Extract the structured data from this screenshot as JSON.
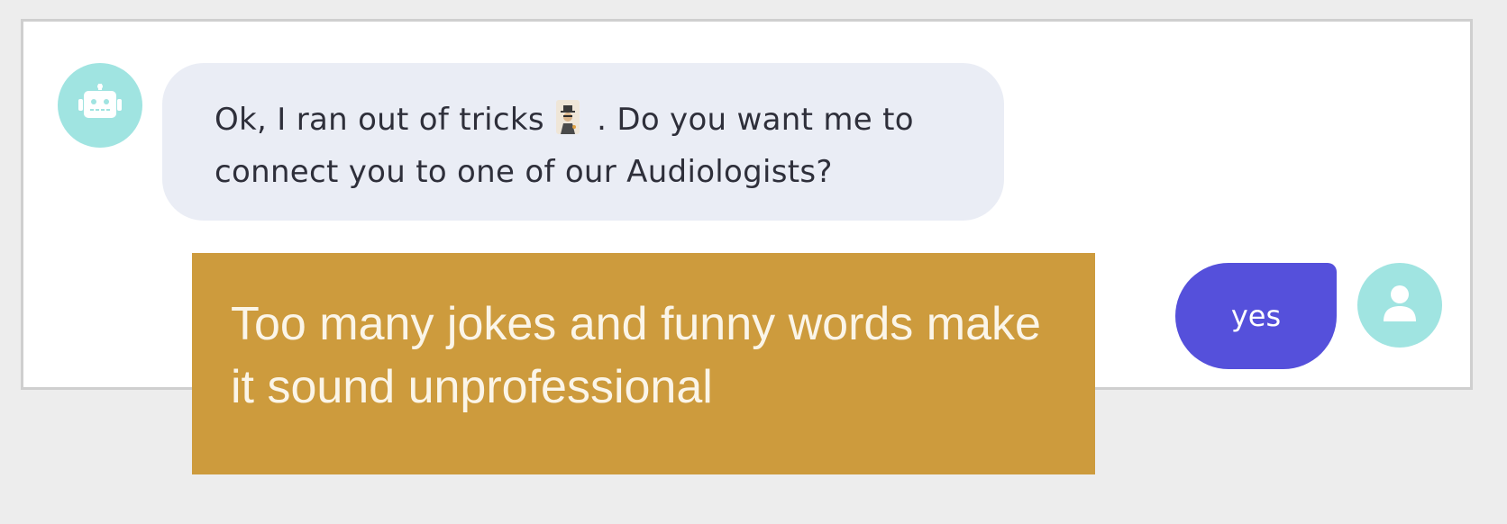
{
  "chat": {
    "bot_message": {
      "text_before_emoji": "Ok, I ran out of tricks",
      "emoji": "trickster-emoji",
      "text_after_emoji": ". Do you want me to connect you to one of our Audiologists?"
    },
    "user_message": "yes",
    "bot_avatar_icon": "robot-icon",
    "user_avatar_icon": "person-icon"
  },
  "overlay": {
    "caption": "Too many jokes and funny words make it sound unprofessional"
  },
  "colors": {
    "avatar_bg": "#a0e4e1",
    "bot_bubble_bg": "#eaedf5",
    "user_bubble_bg": "#5550db",
    "caption_bg": "#cd9b3d"
  }
}
